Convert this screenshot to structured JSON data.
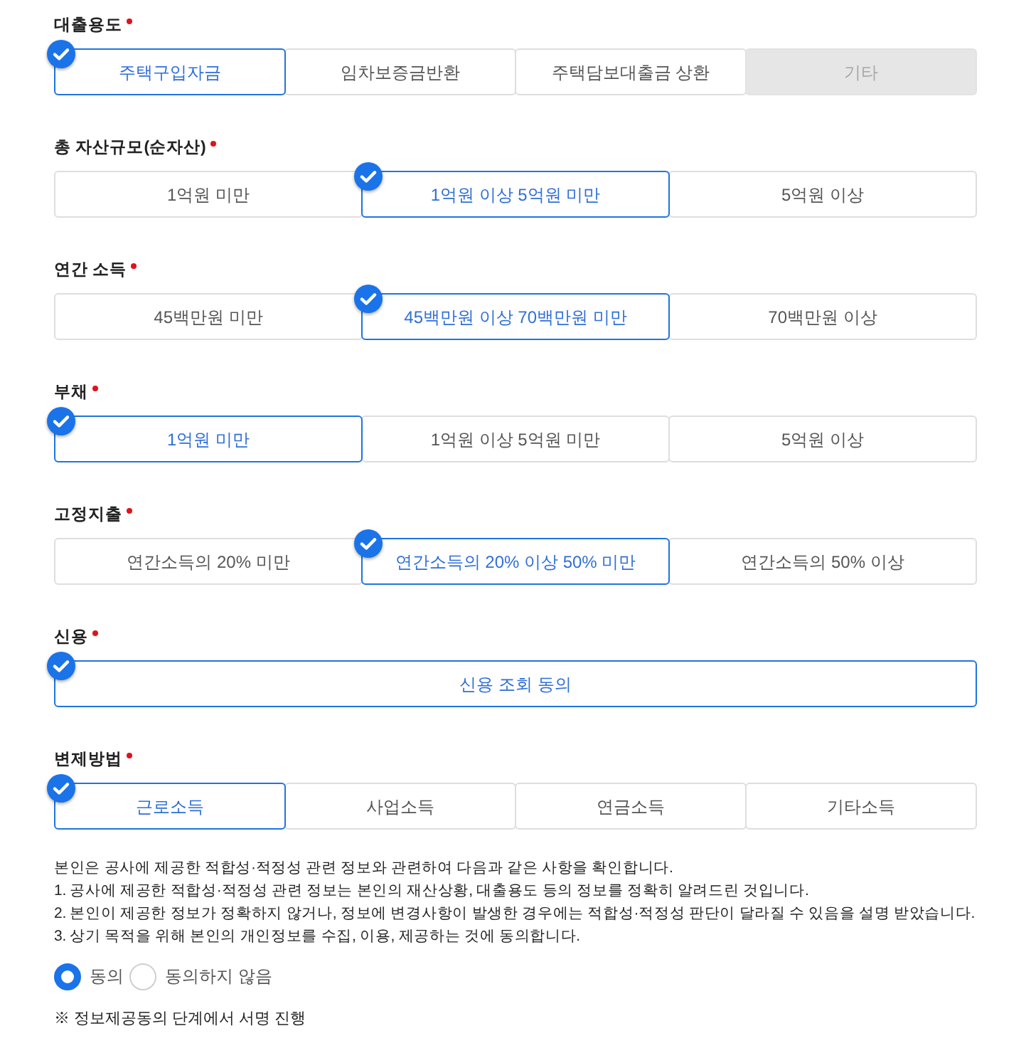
{
  "sections": [
    {
      "label": "대출용도",
      "required": true,
      "options": [
        {
          "label": "주택구입자금",
          "selected": true,
          "disabled": false
        },
        {
          "label": "임차보증금반환",
          "selected": false,
          "disabled": false
        },
        {
          "label": "주택담보대출금 상환",
          "selected": false,
          "disabled": false
        },
        {
          "label": "기타",
          "selected": false,
          "disabled": true
        }
      ]
    },
    {
      "label": "총 자산규모(순자산)",
      "required": true,
      "options": [
        {
          "label": "1억원 미만",
          "selected": false,
          "disabled": false
        },
        {
          "label": "1억원 이상 5억원 미만",
          "selected": true,
          "disabled": false
        },
        {
          "label": "5억원 이상",
          "selected": false,
          "disabled": false
        }
      ]
    },
    {
      "label": "연간 소득",
      "required": true,
      "options": [
        {
          "label": "45백만원 미만",
          "selected": false,
          "disabled": false
        },
        {
          "label": "45백만원 이상 70백만원 미만",
          "selected": true,
          "disabled": false
        },
        {
          "label": "70백만원 이상",
          "selected": false,
          "disabled": false
        }
      ]
    },
    {
      "label": "부채",
      "required": true,
      "options": [
        {
          "label": "1억원 미만",
          "selected": true,
          "disabled": false
        },
        {
          "label": "1억원 이상 5억원 미만",
          "selected": false,
          "disabled": false
        },
        {
          "label": "5억원 이상",
          "selected": false,
          "disabled": false
        }
      ]
    },
    {
      "label": "고정지출",
      "required": true,
      "options": [
        {
          "label": "연간소득의 20% 미만",
          "selected": false,
          "disabled": false
        },
        {
          "label": "연간소득의 20% 이상 50% 미만",
          "selected": true,
          "disabled": false
        },
        {
          "label": "연간소득의 50% 이상",
          "selected": false,
          "disabled": false
        }
      ]
    },
    {
      "label": "신용",
      "required": true,
      "options": [
        {
          "label": "신용 조회 동의",
          "selected": true,
          "disabled": false
        }
      ]
    },
    {
      "label": "변제방법",
      "required": true,
      "options": [
        {
          "label": "근로소득",
          "selected": true,
          "disabled": false
        },
        {
          "label": "사업소득",
          "selected": false,
          "disabled": false
        },
        {
          "label": "연금소득",
          "selected": false,
          "disabled": false
        },
        {
          "label": "기타소득",
          "selected": false,
          "disabled": false
        }
      ]
    }
  ],
  "notice": {
    "intro": "본인은 공사에 제공한 적합성·적정성 관련 정보와 관련하여 다음과 같은 사항을 확인합니다.",
    "items": [
      "1. 공사에 제공한 적합성·적정성 관련 정보는 본인의 재산상황, 대출용도 등의 정보를 정확히 알려드린 것입니다.",
      "2. 본인이 제공한 정보가 정확하지 않거나, 정보에 변경사항이 발생한 경우에는 적합성·적정성 판단이 달라질 수 있음을 설명 받았습니다.",
      "3. 상기 목적을 위해 본인의 개인정보를 수집, 이용, 제공하는 것에 동의합니다."
    ]
  },
  "consent": [
    {
      "label": "동의",
      "selected": true
    },
    {
      "label": "동의하지 않음",
      "selected": false
    }
  ],
  "note": "※ 정보제공동의 단계에서 서명 진행"
}
